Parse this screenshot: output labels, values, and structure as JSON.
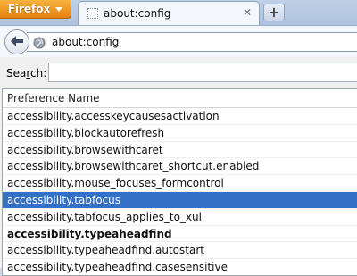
{
  "browser": {
    "menu_button_label": "Firefox",
    "tab_title": "about:config",
    "close_tab_glyph": "✕",
    "new_tab_glyph": "+",
    "url": "about:config"
  },
  "page": {
    "search_label_accesskey": "r",
    "search_label_prefix": "Sea",
    "search_label_suffix": "ch:",
    "search_value": "",
    "column_header": "Preference Name",
    "rows": [
      {
        "name": "accessibility.accesskeycausesactivation"
      },
      {
        "name": "accessibility.blockautorefresh"
      },
      {
        "name": "accessibility.browsewithcaret"
      },
      {
        "name": "accessibility.browsewithcaret_shortcut.enabled"
      },
      {
        "name": "accessibility.mouse_focuses_formcontrol"
      },
      {
        "name": "accessibility.tabfocus"
      },
      {
        "name": "accessibility.tabfocus_applies_to_xul"
      },
      {
        "name": "accessibility.typeaheadfind"
      },
      {
        "name": "accessibility.typeaheadfind.autostart"
      },
      {
        "name": "accessibility.typeaheadfind.casesensitive"
      }
    ],
    "selected_index": 5,
    "bold_index": 7
  },
  "colors": {
    "firefox_button": "#e8890f",
    "selection": "#3470c6"
  },
  "icons": [
    "back-arrow-icon",
    "globe-icon",
    "page-favicon-icon",
    "close-icon",
    "plus-icon"
  ]
}
